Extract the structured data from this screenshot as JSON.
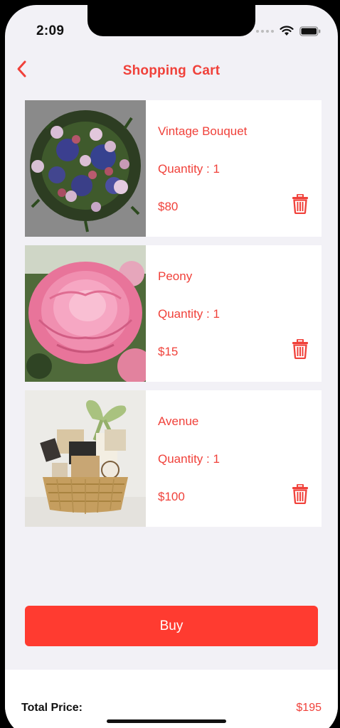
{
  "status_bar": {
    "time": "2:09"
  },
  "nav": {
    "title": "Shopping  Cart",
    "back_icon": "chevron-left-icon"
  },
  "colors": {
    "accent": "#f0413a",
    "button": "#ff3b30",
    "background": "#f2f1f6"
  },
  "cart": {
    "items": [
      {
        "name": "Vintage Bouquet",
        "quantity": "Quantity : 1",
        "price": "$80",
        "image": "bouquet-image"
      },
      {
        "name": "Peony",
        "quantity": "Quantity : 1",
        "price": "$15",
        "image": "peony-image"
      },
      {
        "name": "Avenue",
        "quantity": "Quantity : 1",
        "price": "$100",
        "image": "gift-basket-image"
      }
    ]
  },
  "actions": {
    "buy_label": "Buy"
  },
  "footer": {
    "total_label": "Total Price:",
    "total_value": "$195"
  }
}
